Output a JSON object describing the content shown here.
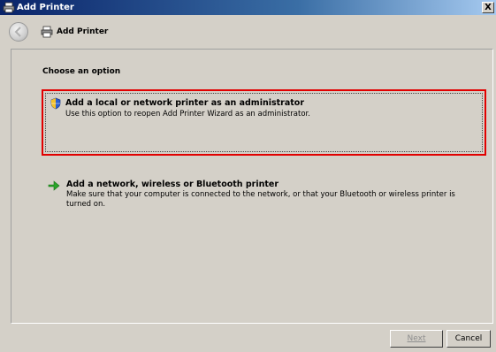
{
  "window": {
    "title": "Add Printer",
    "close_label": "X"
  },
  "nav": {
    "title": "Add Printer"
  },
  "content": {
    "heading": "Choose an option",
    "options": [
      {
        "title": "Add a local or network printer as an administrator",
        "description": "Use this option to reopen Add Printer Wizard as an administrator.",
        "icon": "uac-shield-icon",
        "selected": true
      },
      {
        "title": "Add a network, wireless or Bluetooth printer",
        "description": "Make sure that your computer is connected to the network, or that your Bluetooth or wireless printer is turned on.",
        "icon": "green-arrow-icon",
        "selected": false
      }
    ]
  },
  "footer": {
    "next_label": "Next",
    "cancel_label": "Cancel"
  },
  "colors": {
    "selection_border": "#e10000",
    "titlebar": "#0a246a",
    "dialog_bg": "#d4d0c8"
  }
}
